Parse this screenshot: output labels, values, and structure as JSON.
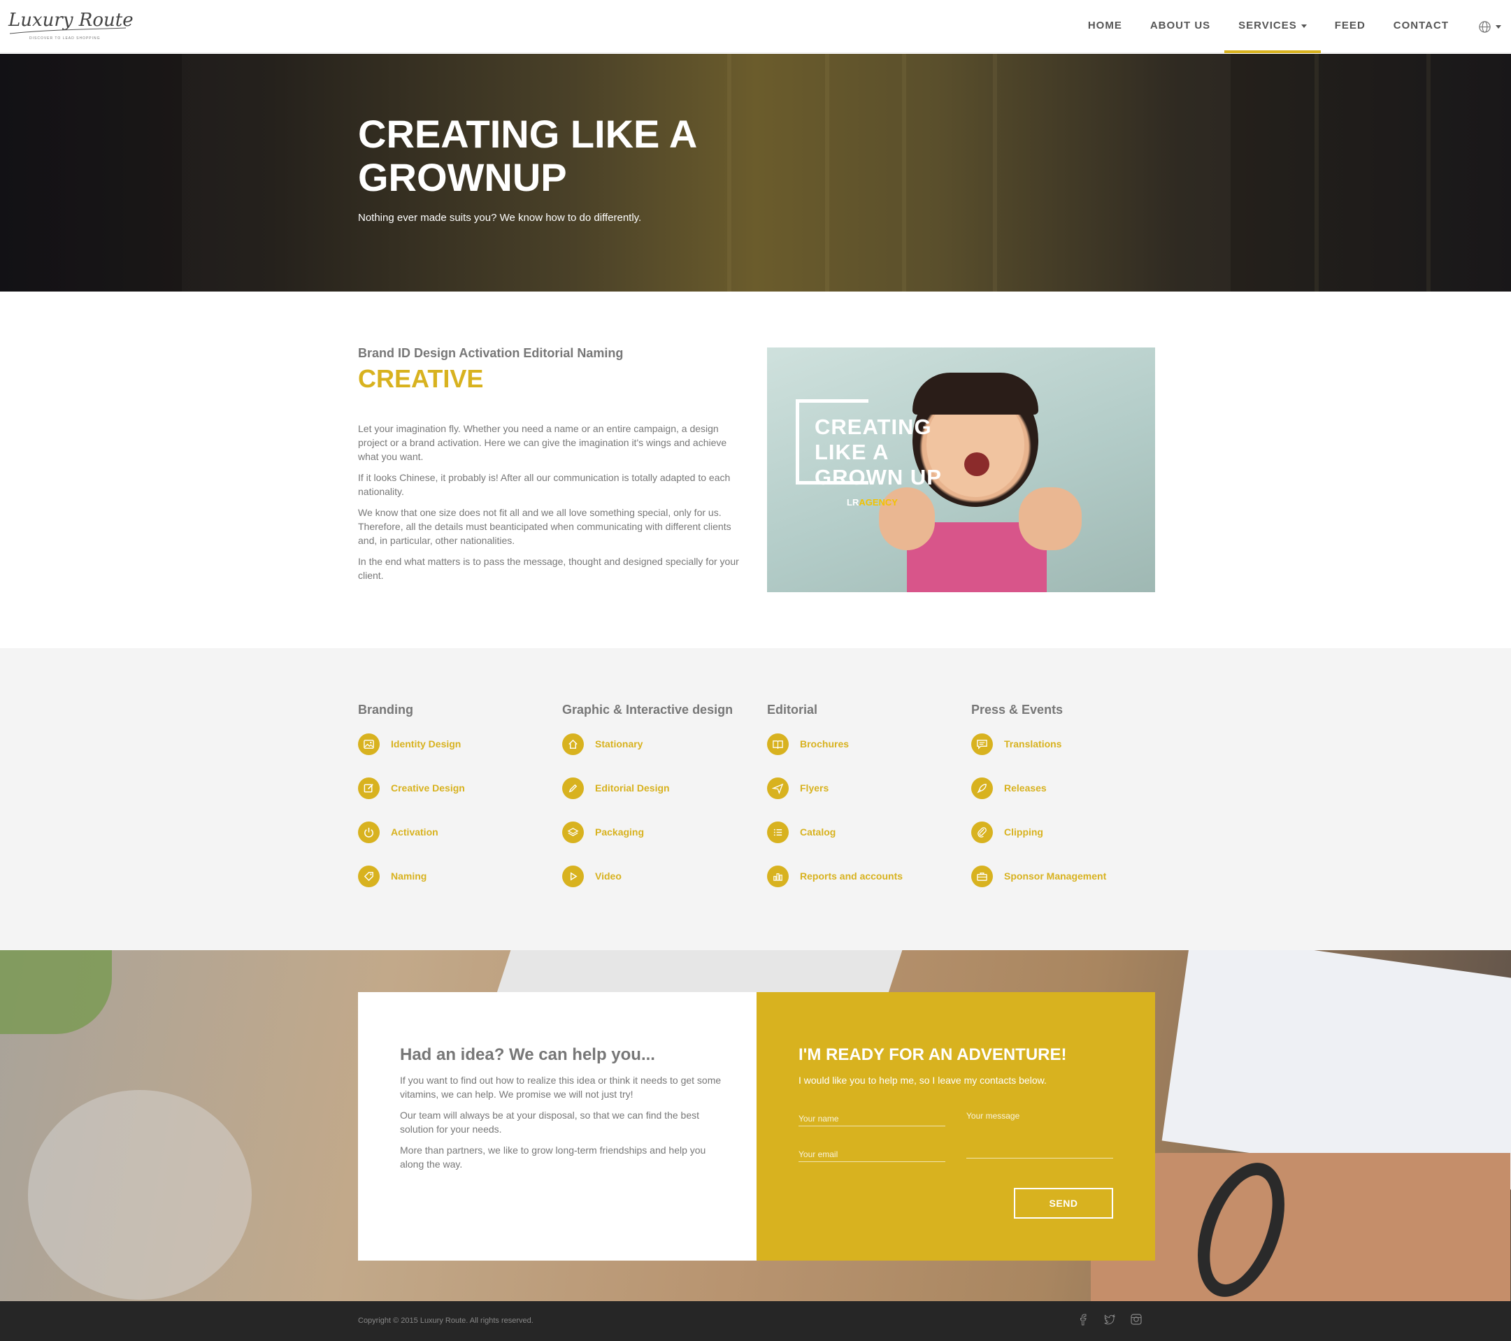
{
  "brand": {
    "name": "Luxury Route",
    "tagline": "DISCOVER TO LEAD SHOPPING"
  },
  "nav": {
    "items": [
      {
        "label": "HOME"
      },
      {
        "label": "ABOUT US"
      },
      {
        "label": "SERVICES",
        "active": true
      },
      {
        "label": "FEED"
      },
      {
        "label": "CONTACT"
      }
    ],
    "language_icon": "globe-icon"
  },
  "hero": {
    "title": "CREATING LIKE A GROWNUP",
    "subtitle": "Nothing ever made suits you? We know how to do differently."
  },
  "creative": {
    "kicker": "Brand ID Design Activation Editorial Naming",
    "title": "CREATIVE",
    "paragraphs": [
      "Let your imagination fly. Whether you need a name or an entire campaign, a design project or a brand activation. Here we can give the imagination it's wings and achieve what you want.",
      "If it looks Chinese, it probably is! After all our communication is totally adapted to each nationality.",
      "We know that one size does not fit all and we all love something special, only for us. Therefore, all the details must beanticipated when communicating with different clients and, in particular, other nationalities.",
      "In the end what matters is to pass the message, thought and designed specially for your client."
    ],
    "image_overlay": "CREATING LIKE A GROWN UP",
    "image_tag_a": "LR",
    "image_tag_b": "AGENCY"
  },
  "services": {
    "columns": [
      {
        "title": "Branding",
        "items": [
          {
            "label": "Identity Design",
            "icon": "image-icon"
          },
          {
            "label": "Creative Design",
            "icon": "edit-icon"
          },
          {
            "label": "Activation",
            "icon": "power-icon"
          },
          {
            "label": "Naming",
            "icon": "tag-icon"
          }
        ]
      },
      {
        "title": "Graphic & Interactive design",
        "items": [
          {
            "label": "Stationary",
            "icon": "home-icon"
          },
          {
            "label": "Editorial Design",
            "icon": "pencil-icon"
          },
          {
            "label": "Packaging",
            "icon": "layers-icon"
          },
          {
            "label": "Video",
            "icon": "play-icon"
          }
        ]
      },
      {
        "title": "Editorial",
        "items": [
          {
            "label": "Brochures",
            "icon": "book-icon"
          },
          {
            "label": "Flyers",
            "icon": "paper-plane-icon"
          },
          {
            "label": "Catalog",
            "icon": "list-icon"
          },
          {
            "label": "Reports and accounts",
            "icon": "bar-chart-icon"
          }
        ]
      },
      {
        "title": "Press & Events",
        "items": [
          {
            "label": "Translations",
            "icon": "chat-icon"
          },
          {
            "label": "Releases",
            "icon": "rocket-icon"
          },
          {
            "label": "Clipping",
            "icon": "paperclip-icon"
          },
          {
            "label": "Sponsor Management",
            "icon": "briefcase-icon"
          }
        ]
      }
    ]
  },
  "contact": {
    "left_title": "Had an idea? We can help you...",
    "left_paragraphs": [
      "If you want to find out how to realize this idea or think it needs to get some vitamins, we can help. We promise we will not just try!",
      "Our team will always be at your disposal, so that we can find the best solution for your needs.",
      "More than partners, we like to grow long-term friendships and help you along the way."
    ],
    "right_title": "I'M READY FOR AN ADVENTURE!",
    "right_subtitle": "I would like you to help me, so I leave my contacts below.",
    "name_placeholder": "Your name",
    "email_placeholder": "Your email",
    "message_placeholder": "Your message",
    "send_label": "SEND"
  },
  "footer": {
    "copyright": "Copyright © 2015 Luxury Route. All rights reserved.",
    "social": [
      "facebook-icon",
      "twitter-icon",
      "instagram-icon"
    ]
  },
  "colors": {
    "accent": "#d8b21f",
    "footer_bg": "#262626",
    "section_bg": "#f4f4f4"
  }
}
